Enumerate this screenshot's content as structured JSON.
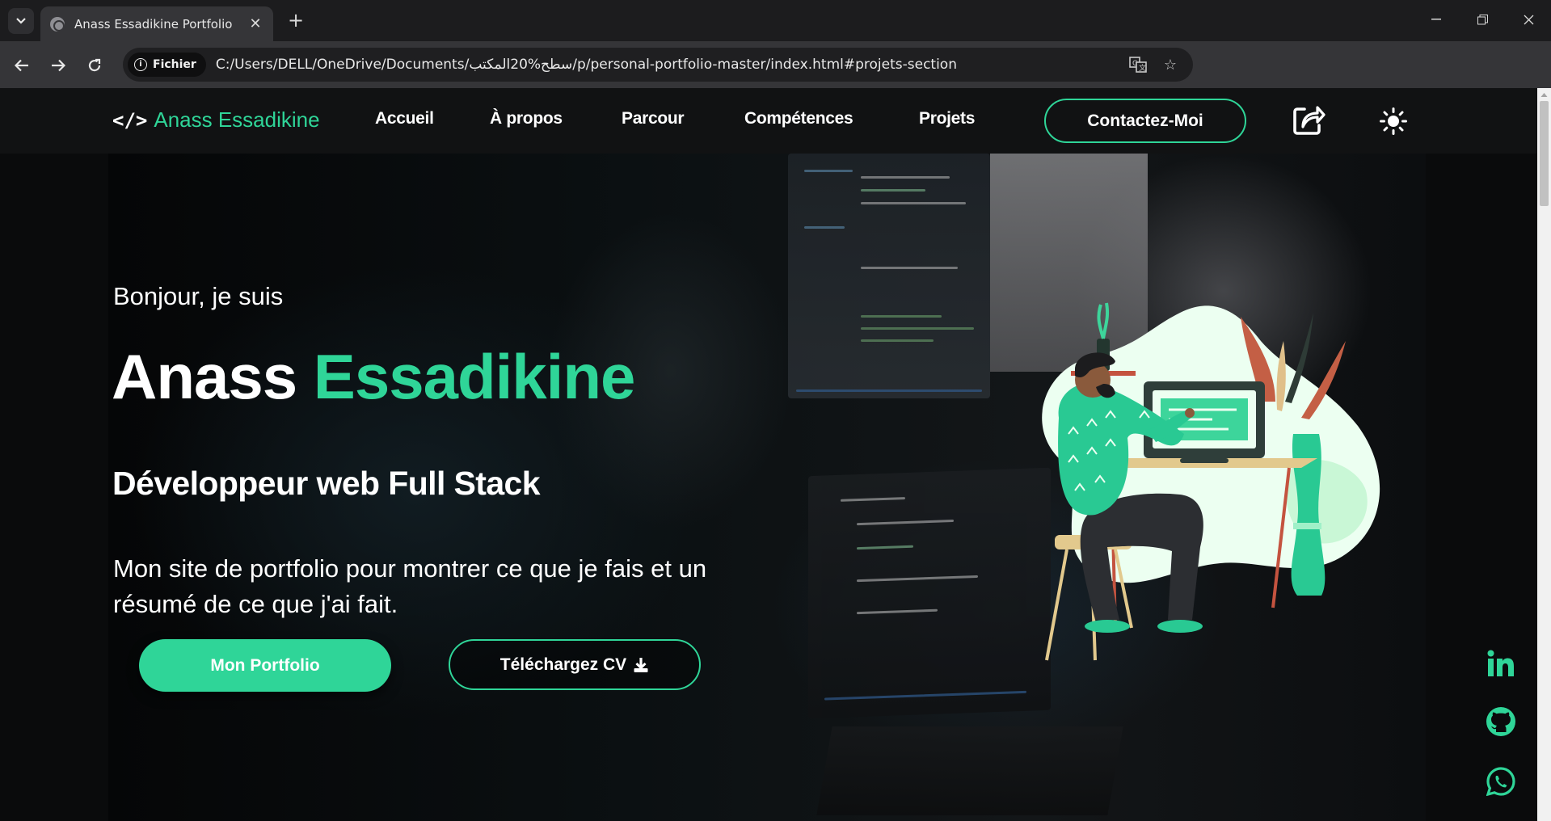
{
  "browser": {
    "tab_title": "Anass Essadikine Portfolio",
    "chip_label": "Fichier",
    "url": "C:/Users/DELL/OneDrive/Documents/سطح%20المكتب/p/personal-portfolio-master/index.html#projets-section",
    "extensions": [
      "camera-icon",
      "b-extension-icon",
      "notion-icon",
      "stack-icon",
      "puzzle-icon",
      "download-icon",
      "sidepanel-icon"
    ]
  },
  "nav": {
    "brand_code": "</>",
    "brand": "Anass Essadikine",
    "links": [
      "Accueil",
      "À propos",
      "Parcour",
      "Compétences",
      "Projets"
    ],
    "contact": "Contactez-Moi"
  },
  "hero": {
    "greeting": "Bonjour, je suis",
    "first_name": "Anass",
    "last_name": "Essadikine",
    "role": "Développeur web Full Stack",
    "description": "Mon site de portfolio pour montrer ce que je fais et un résumé de ce que j'ai fait.",
    "primary_button": "Mon Portfolio",
    "secondary_button": "Téléchargez CV"
  },
  "social": [
    "linkedin-icon",
    "github-icon",
    "whatsapp-icon"
  ],
  "colors": {
    "accent": "#2fd598",
    "navbar": "#111213",
    "background": "#0a0b0c"
  }
}
